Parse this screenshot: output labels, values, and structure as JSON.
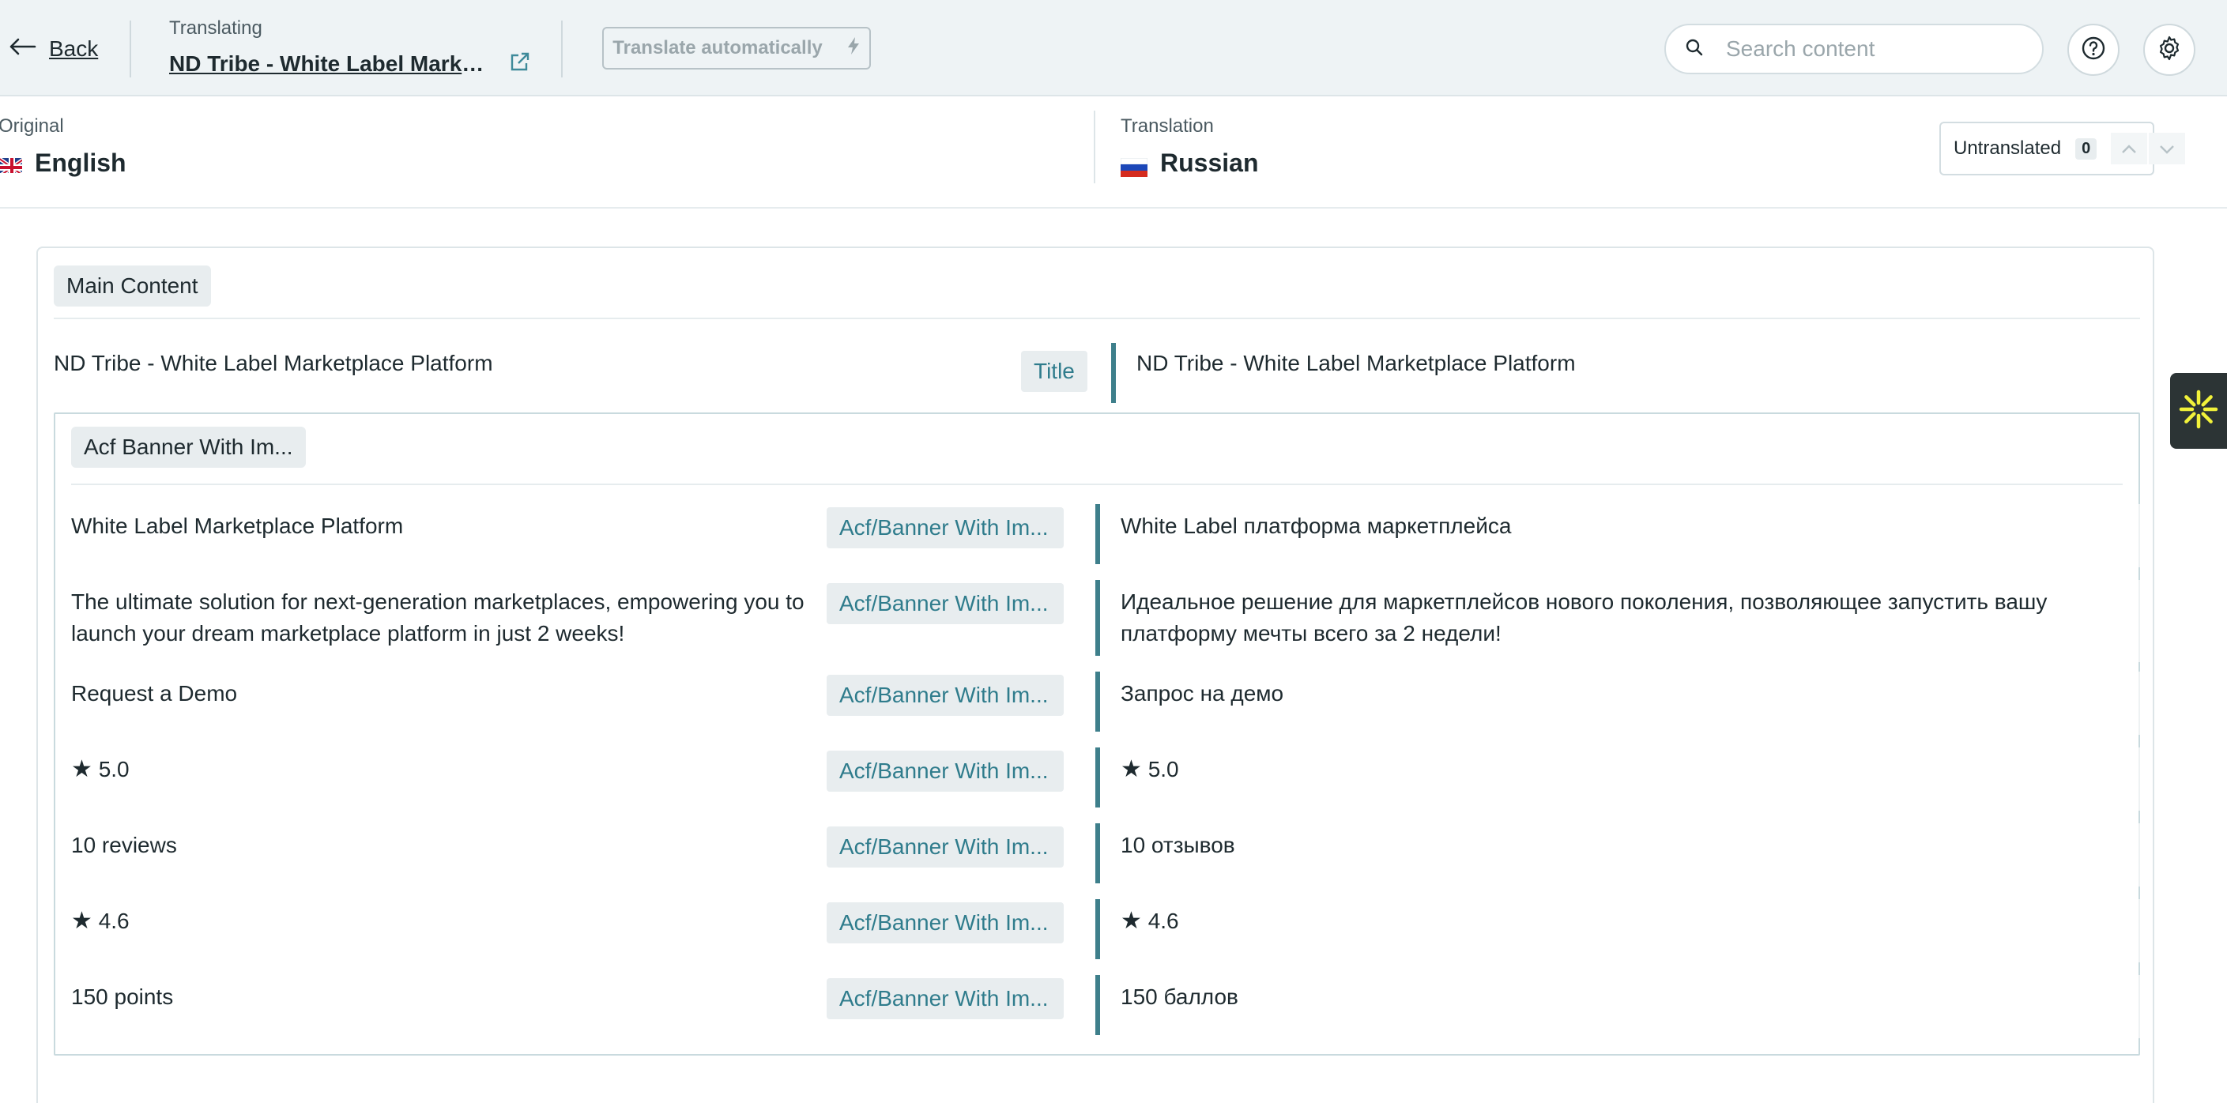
{
  "topbar": {
    "back_label": "Back",
    "translating_caption": "Translating",
    "page_title": "ND Tribe - White Label Market...",
    "translate_auto_label": "Translate automatically",
    "search_placeholder": "Search content"
  },
  "languages": {
    "original_caption": "Original",
    "original_name": "English",
    "translation_caption": "Translation",
    "translation_name": "Russian",
    "untranslated_label": "Untranslated",
    "untranslated_count": "0"
  },
  "content": {
    "section_label": "Main Content",
    "title_row": {
      "original": "ND Tribe - White Label Marketplace Platform",
      "badge": "Title",
      "translation": "ND Tribe - White Label Marketplace Platform"
    },
    "group_label": "Acf Banner With Im...",
    "rows": [
      {
        "original": "White Label Marketplace Platform",
        "badge": "Acf/Banner With Im...",
        "translation": "White Label платформа маркетплейса"
      },
      {
        "original": "The ultimate solution for next-generation marketplaces, empowering you to launch your dream marketplace platform in just 2 weeks!",
        "badge": "Acf/Banner With Im...",
        "translation": "Идеальное решение для маркетплейсов нового поколения, позволяющее запустить вашу платформу мечты всего за 2 недели!"
      },
      {
        "original": "Request a Demo",
        "badge": "Acf/Banner With Im...",
        "translation": "Запрос на демо"
      },
      {
        "original": "5.0",
        "badge": "Acf/Banner With Im...",
        "translation": "5.0"
      },
      {
        "original": "10 reviews",
        "badge": "Acf/Banner With Im...",
        "translation": "10 отзывов"
      },
      {
        "original": "4.6",
        "badge": "Acf/Banner With Im...",
        "translation": "4.6"
      },
      {
        "original": "150 points",
        "badge": "Acf/Banner With Im...",
        "translation": "150 баллов"
      }
    ]
  },
  "icons": {
    "back": "arrow-left-icon",
    "external_link": "external-link-icon",
    "bolt": "lightning-icon",
    "search": "search-icon",
    "help": "question-circle-icon",
    "settings": "gear-icon",
    "star": "star-icon",
    "widget": "asterisk-burst-icon"
  },
  "colors": {
    "accent": "#2f7c8c",
    "bar": "#3e7f8b",
    "topbar_bg": "#eef3f5",
    "widget_bg": "#2c3435",
    "widget_fg": "#f2f23a"
  }
}
